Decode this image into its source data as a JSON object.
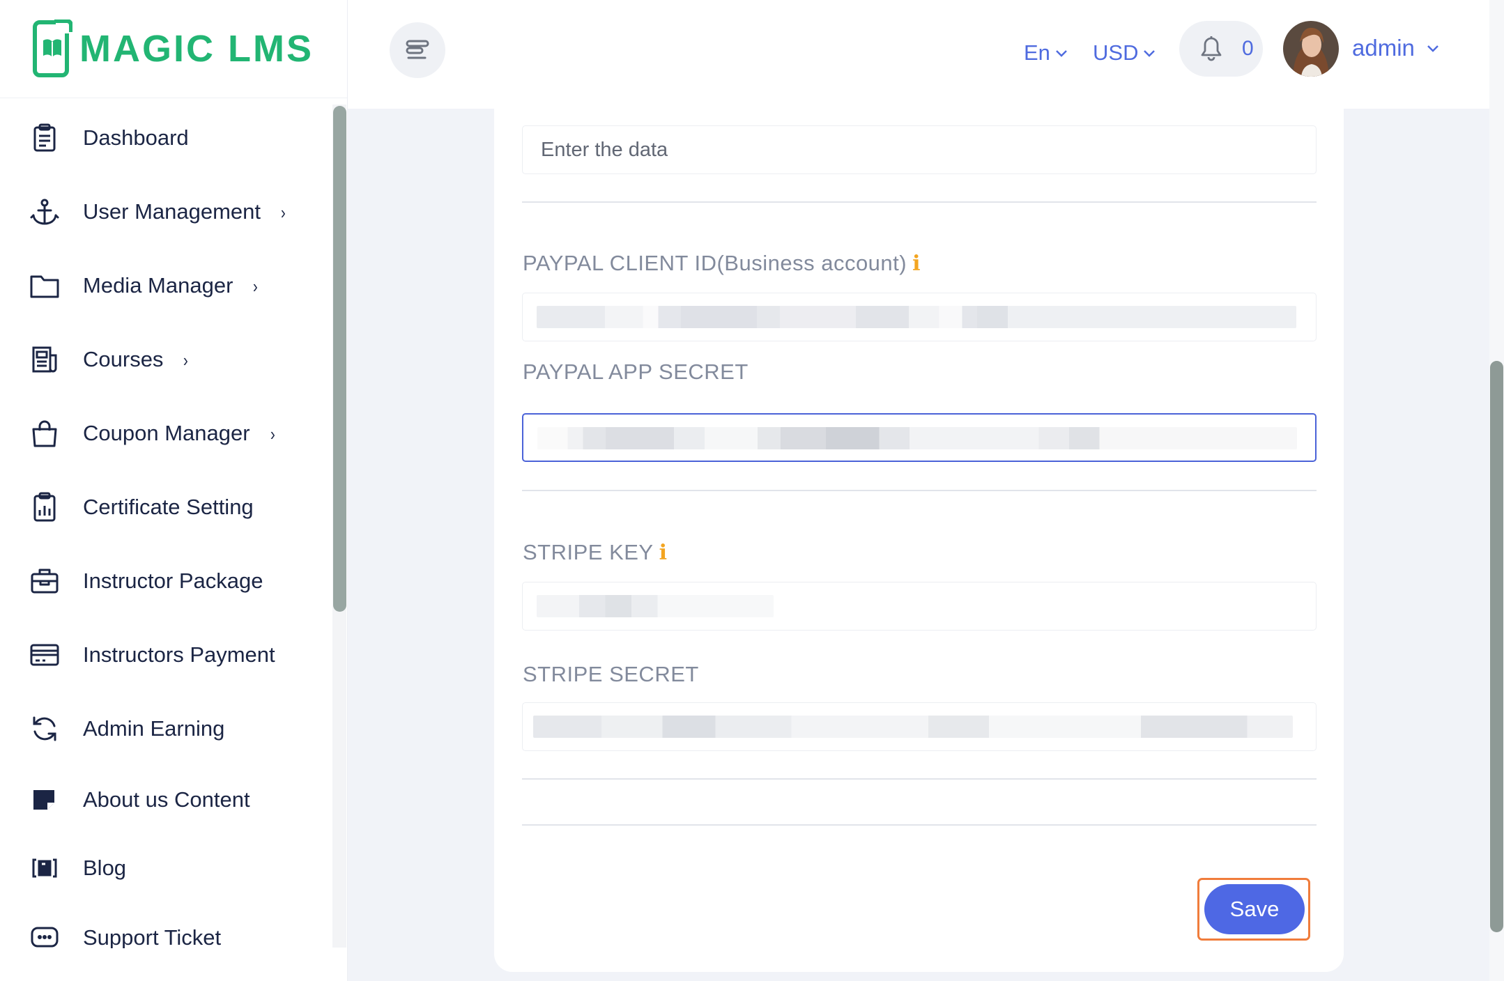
{
  "brand": {
    "name": "MAGIC LMS",
    "color": "#22b573"
  },
  "sidebar": {
    "items": [
      {
        "label": "Dashboard",
        "icon": "clipboard-icon",
        "has_submenu": false
      },
      {
        "label": "User Management",
        "icon": "anchor-icon",
        "has_submenu": true
      },
      {
        "label": "Media Manager",
        "icon": "folder-icon",
        "has_submenu": true
      },
      {
        "label": "Courses",
        "icon": "newspaper-icon",
        "has_submenu": true
      },
      {
        "label": "Coupon Manager",
        "icon": "shopping-bag-icon",
        "has_submenu": true
      },
      {
        "label": "Certificate Setting",
        "icon": "clipboard-chart-icon",
        "has_submenu": false
      },
      {
        "label": "Instructor Package",
        "icon": "briefcase-icon",
        "has_submenu": false
      },
      {
        "label": "Instructors Payment",
        "icon": "credit-card-icon",
        "has_submenu": false
      },
      {
        "label": "Admin Earning",
        "icon": "refresh-icon",
        "has_submenu": false
      },
      {
        "label": "About us Content",
        "icon": "sticky-note-icon",
        "has_submenu": false
      },
      {
        "label": "Blog",
        "icon": "blog-icon",
        "has_submenu": false
      },
      {
        "label": "Support Ticket",
        "icon": "chat-icon",
        "has_submenu": false
      }
    ],
    "chevron": "›"
  },
  "header": {
    "language": "En",
    "currency": "USD",
    "notification_count": "0",
    "user_name": "admin",
    "accent_color": "#4f6bdf"
  },
  "form": {
    "top_field": {
      "placeholder": "Enter the data",
      "value": ""
    },
    "paypal_client_id": {
      "label": "PAYPAL CLIENT ID(Business account)",
      "has_info": true,
      "info_icon": "i"
    },
    "paypal_app_secret": {
      "label": "PAYPAL APP SECRET",
      "has_info": false
    },
    "stripe_key": {
      "label": "STRIPE KEY",
      "has_info": true,
      "info_icon": "i"
    },
    "stripe_secret": {
      "label": "STRIPE SECRET",
      "has_info": false
    },
    "save_label": "Save"
  }
}
